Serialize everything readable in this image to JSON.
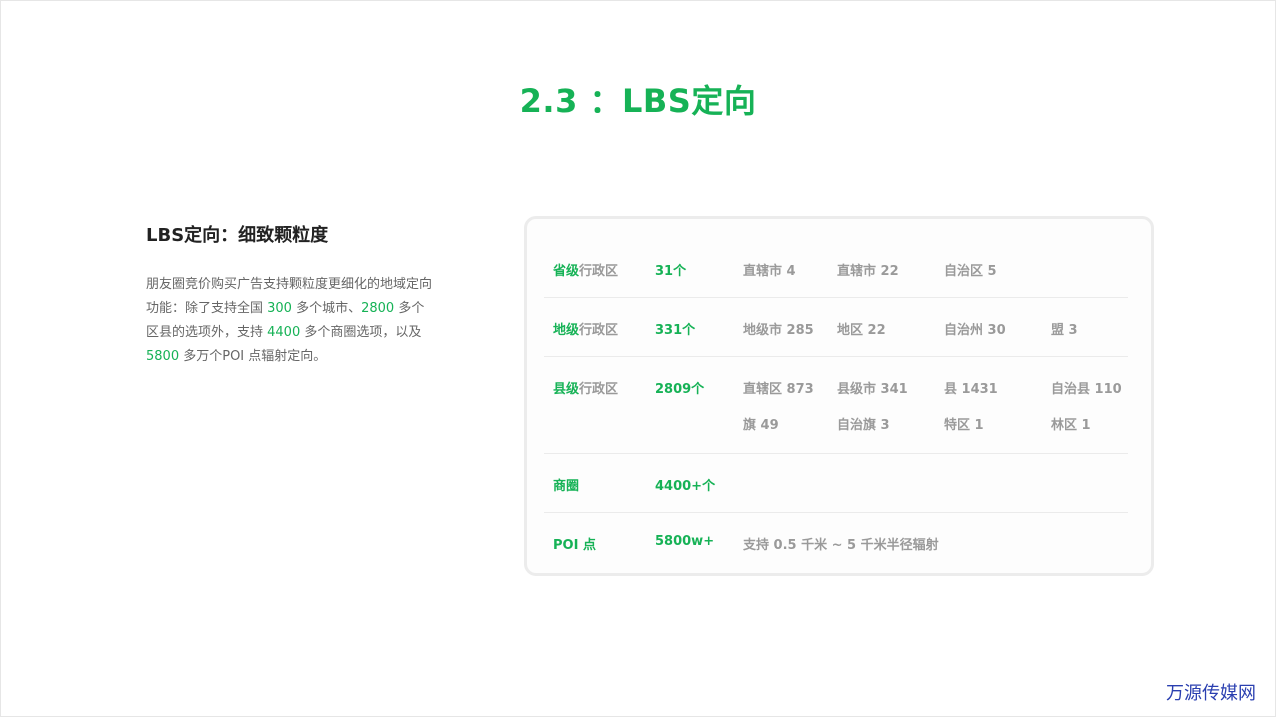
{
  "title": "2.3 ：LBS定向",
  "left": {
    "heading": "LBS定向：细致颗粒度",
    "para": [
      {
        "t": "朋友圈竞价购买广告支持颗粒度更细化的地域定向功能：除了支持全国 ",
        "hl": false
      },
      {
        "t": "300",
        "hl": true
      },
      {
        "t": " 多个城市、",
        "hl": false
      },
      {
        "t": "2800",
        "hl": true
      },
      {
        "t": " 多个区县的选项外，支持 ",
        "hl": false
      },
      {
        "t": "4400",
        "hl": true
      },
      {
        "t": " 多个商圈选项，以及 ",
        "hl": false
      },
      {
        "t": "5800",
        "hl": true
      },
      {
        "t": " 多万个POI 点辐射定向。",
        "hl": false
      }
    ]
  },
  "table": {
    "rows": [
      {
        "label_main": "省级",
        "label_sub": "行政区",
        "count": "31个",
        "items": [
          [
            "直辖市 4",
            "直辖市 22",
            "自治区 5",
            ""
          ]
        ]
      },
      {
        "label_main": "地级",
        "label_sub": "行政区",
        "count": "331个",
        "items": [
          [
            "地级市 285",
            "地区 22",
            "自治州 30",
            "盟 3"
          ]
        ]
      },
      {
        "label_main": "县级",
        "label_sub": "行政区",
        "count": "2809个",
        "items": [
          [
            "直辖区 873",
            "县级市 341",
            "县 1431",
            "自治县 110"
          ],
          [
            "旗 49",
            "自治旗 3",
            "特区 1",
            "林区 1"
          ]
        ]
      },
      {
        "label_main": "商圈",
        "label_sub": "",
        "count": "4400+个",
        "items": []
      },
      {
        "label_main": "POI 点",
        "label_sub": "",
        "count": "5800w+",
        "items": [
          [
            "支持 0.5 千米 ~ 5 千米半径辐射"
          ]
        ]
      }
    ]
  },
  "watermark": "万源传媒网",
  "colors": {
    "accent": "#16b256",
    "muted": "#9a9a9a"
  }
}
